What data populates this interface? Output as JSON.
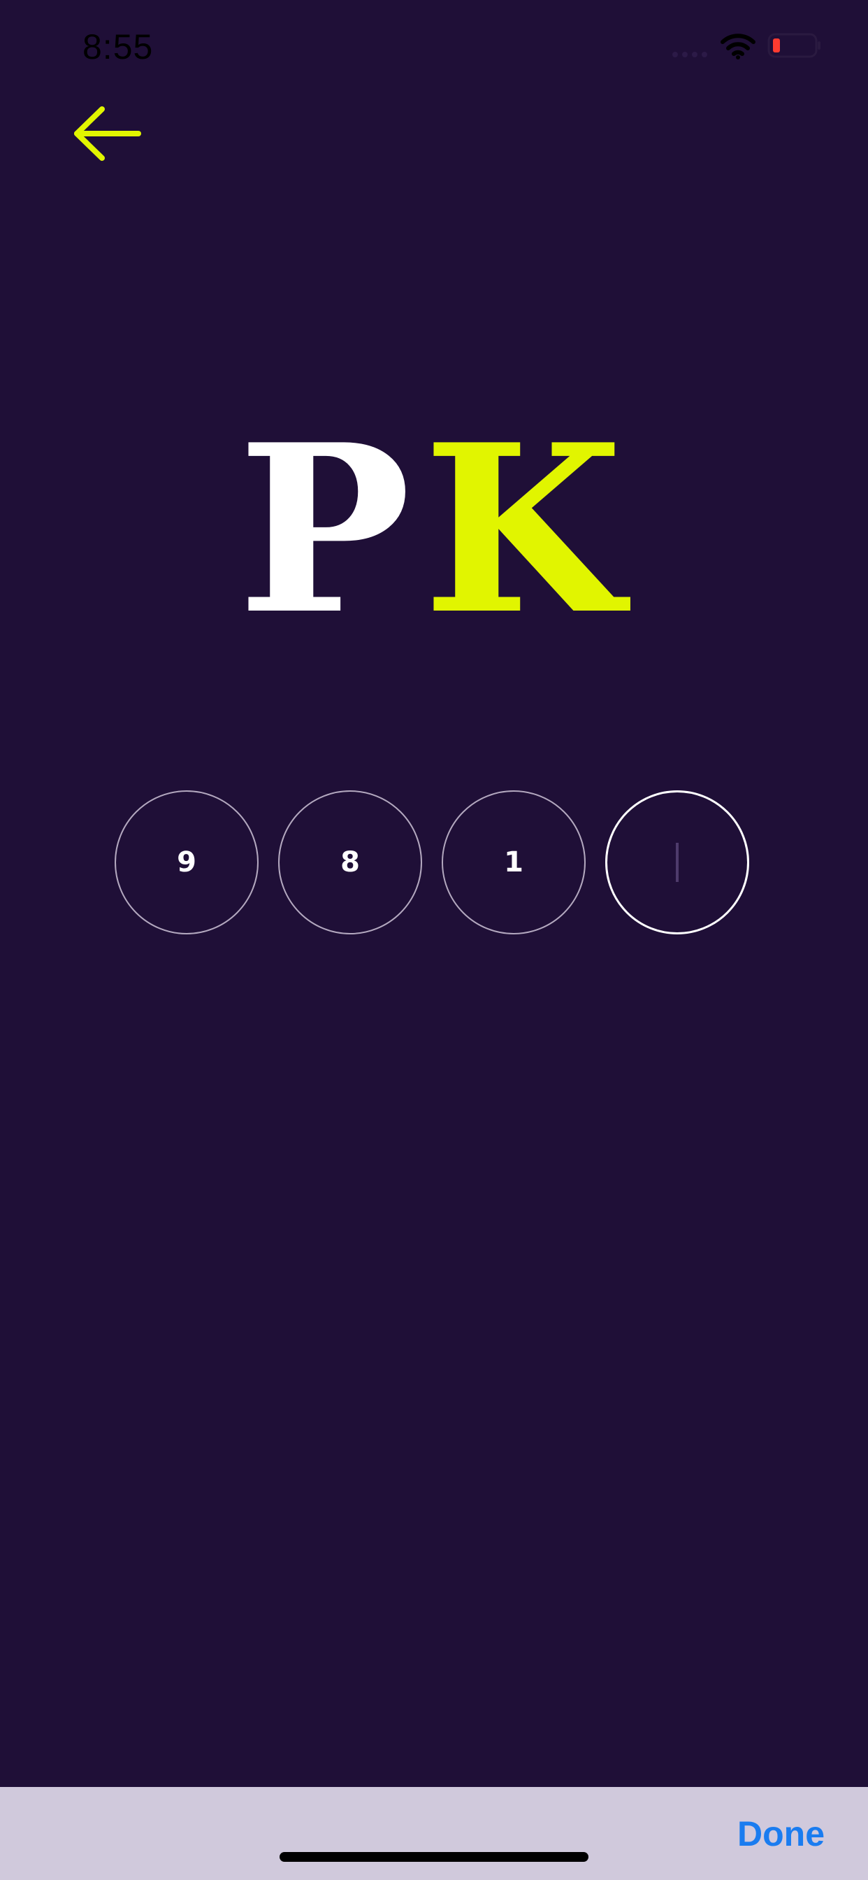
{
  "status_bar": {
    "time": "8:55",
    "signal_icon": "signal-dots-icon",
    "wifi_icon": "wifi-icon",
    "battery_icon": "battery-low-icon",
    "battery_color": "#ff3b30"
  },
  "nav": {
    "back_icon": "arrow-left-icon",
    "accent_color": "#e1f500"
  },
  "logo": {
    "letter_1": "P",
    "letter_2": "K",
    "letter_1_color": "#ffffff",
    "letter_2_color": "#e1f500"
  },
  "pin": {
    "digits": [
      "9",
      "8",
      "1",
      ""
    ],
    "active_index": 3
  },
  "keyboard_toolbar": {
    "done_label": "Done"
  },
  "colors": {
    "background": "#1f0f37",
    "toolbar": "#d0c9dc",
    "done": "#1a7cf0"
  }
}
